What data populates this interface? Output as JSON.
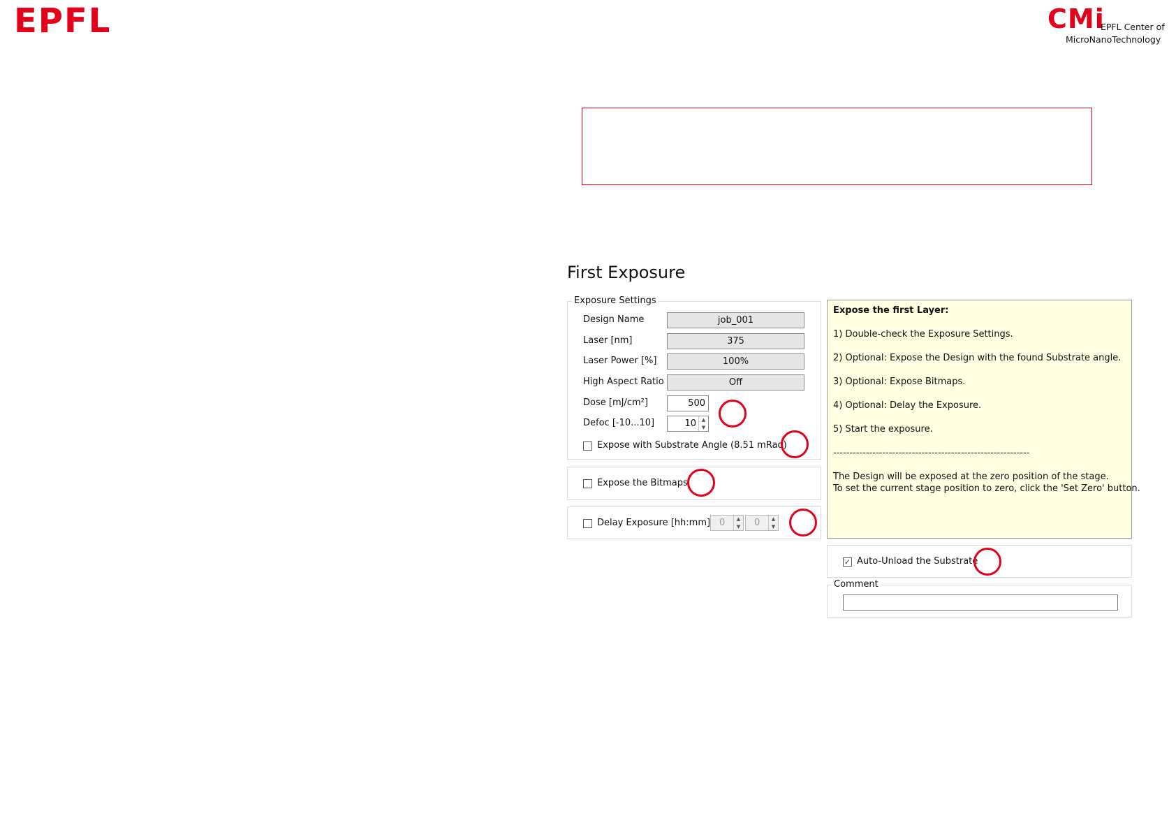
{
  "logos": {
    "epfl": "EPFL",
    "cmi_mark": "CMi",
    "cmi_line1": "EPFL Center of",
    "cmi_line2": "MicroNanoTechnology"
  },
  "colors": {
    "brand_red": "#e2001a",
    "info_bg": "#ffffe1",
    "field_ro_bg": "#e6e6e6"
  },
  "page_title": "First Exposure",
  "exposure_settings": {
    "legend": "Exposure Settings",
    "design_name": {
      "label": "Design Name",
      "value": "job_001"
    },
    "laser": {
      "label": "Laser [nm]",
      "value": "375"
    },
    "laser_power": {
      "label": "Laser Power [%]",
      "value": "100%"
    },
    "high_aspect": {
      "label": "High Aspect Ratio",
      "value": "Off"
    },
    "dose": {
      "label": "Dose [mJ/cm²]",
      "value": "500"
    },
    "defoc": {
      "label": "Defoc [-10...10]",
      "value": "10"
    },
    "substrate_angle": {
      "label": "Expose with Substrate Angle (8.51 mRad)",
      "checked": false
    }
  },
  "bitmaps": {
    "label": "Expose the Bitmaps",
    "checked": false
  },
  "delay": {
    "label": "Delay Exposure [hh:mm]",
    "checked": false,
    "hours": "0",
    "minutes": "0"
  },
  "info": {
    "title": "Expose the first Layer:",
    "step1": "1) Double-check the Exposure Settings.",
    "step2": "2) Optional: Expose the Design with the found Substrate angle.",
    "step3": "3) Optional: Expose Bitmaps.",
    "step4": "4) Optional: Delay the Exposure.",
    "step5": "5) Start the exposure.",
    "separator": "------------------------------------------------------------",
    "note1": "The Design will be exposed at the zero position of the stage.",
    "note2": "To set the current stage position to zero, click the 'Set Zero' button."
  },
  "auto_unload": {
    "label": "Auto-Unload the Substrate",
    "checked": true,
    "mark": "✓"
  },
  "comment": {
    "legend": "Comment",
    "value": ""
  },
  "spinner": {
    "up": "▲",
    "down": "▼"
  }
}
